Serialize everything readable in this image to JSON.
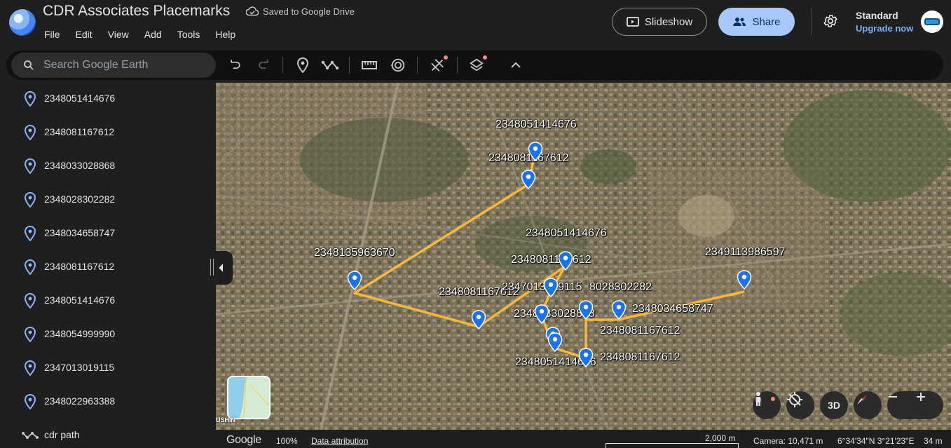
{
  "header": {
    "title": "CDR Associates Placemarks",
    "save_status": "Saved to Google Drive",
    "menu": [
      "File",
      "Edit",
      "View",
      "Add",
      "Tools",
      "Help"
    ],
    "slideshow_label": "Slideshow",
    "share_label": "Share",
    "plan_name": "Standard",
    "upgrade_label": "Upgrade now"
  },
  "toolbar": {
    "search_placeholder": "Search Google Earth",
    "tools": [
      "undo-icon",
      "redo-icon",
      "placemark-icon",
      "draw-path-icon",
      "measure-icon",
      "history-icon",
      "satellite-tools-icon",
      "layers-icon",
      "chevron-up-icon"
    ]
  },
  "sidebar": {
    "items": [
      {
        "label": "2348051414676",
        "icon": "placemark-icon"
      },
      {
        "label": "2348081167612",
        "icon": "placemark-icon"
      },
      {
        "label": "2348033028868",
        "icon": "placemark-icon"
      },
      {
        "label": "2348028302282",
        "icon": "placemark-icon"
      },
      {
        "label": "2348034658747",
        "icon": "placemark-icon"
      },
      {
        "label": "2348081167612",
        "icon": "placemark-icon"
      },
      {
        "label": "2348051414676",
        "icon": "placemark-icon"
      },
      {
        "label": "2348054999990",
        "icon": "placemark-icon"
      },
      {
        "label": "2347013019115",
        "icon": "placemark-icon"
      },
      {
        "label": "2348022963388",
        "icon": "placemark-icon"
      },
      {
        "label": "cdr path",
        "icon": "path-icon"
      }
    ]
  },
  "map": {
    "path_color": "#f6b73c",
    "pin_color": "#1a73e8",
    "labels": [
      "2348051414676",
      "2348081167612",
      "2348051414676",
      "2348135963670",
      "2348081167612",
      "2348081167612",
      "2347013019115",
      "8028302282",
      "2349113986597",
      "2348033028868",
      "2348034658747",
      "2348081167612",
      "2348081167612",
      "2348051414676"
    ],
    "minimap_caption": "USHIN",
    "view_mode_label": "3D"
  },
  "footer": {
    "wordmark": "Google",
    "zoom": "100%",
    "attribution": "Data attribution",
    "scale": "2,000 m",
    "camera": "Camera: 10,471 m",
    "coords": "6°34'34\"N 3°21'23\"E",
    "elevation": "34 m"
  }
}
